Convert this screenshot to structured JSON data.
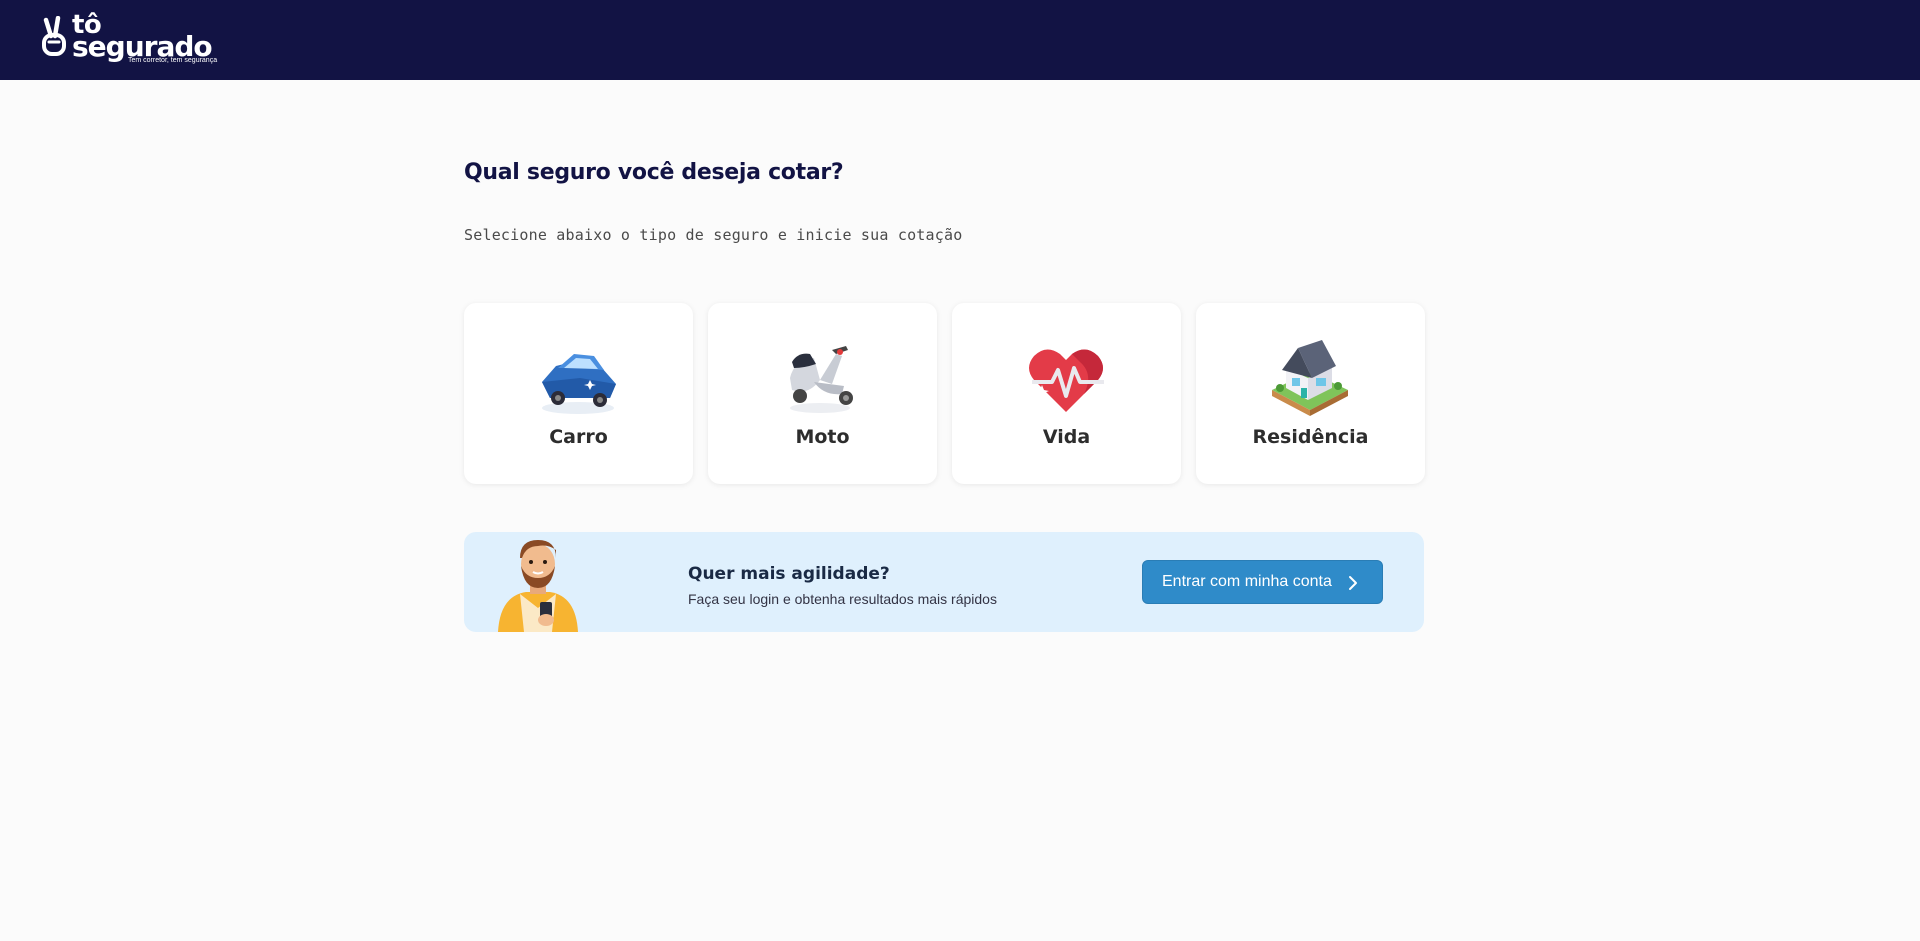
{
  "header": {
    "logo": {
      "line1": "tô",
      "line2": "segurado",
      "tagline": "Tem corretor, tem segurança"
    }
  },
  "main": {
    "title": "Qual seguro você deseja cotar?",
    "subtitle": "Selecione abaixo o tipo de seguro e inicie sua cotação",
    "cards": [
      {
        "label": "Carro",
        "icon": "car-icon"
      },
      {
        "label": "Moto",
        "icon": "scooter-icon"
      },
      {
        "label": "Vida",
        "icon": "heart-icon"
      },
      {
        "label": "Residência",
        "icon": "house-icon"
      }
    ]
  },
  "banner": {
    "title": "Quer mais agilidade?",
    "text": "Faça seu login e obtenha resultados mais rápidos",
    "button_label": "Entrar com minha conta"
  },
  "colors": {
    "header_bg": "#121344",
    "title": "#121344",
    "banner_bg": "#dff0fd",
    "button": "#2f8bc9"
  }
}
